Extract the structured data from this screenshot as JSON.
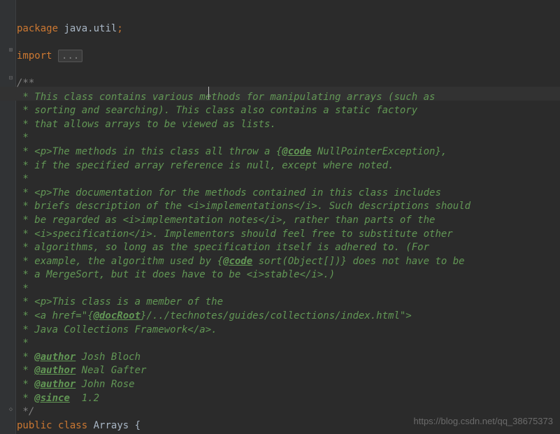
{
  "package_keyword": "package",
  "package_name": "java.util",
  "import_keyword": "import",
  "import_folded": "...",
  "doc": {
    "l0": "/**",
    "l1": " * This class contains various methods for manipulating arrays (such as",
    "l2": " * sorting and searching). This class also contains a static factory",
    "l3": " * that allows arrays to be viewed as lists.",
    "l4": " *",
    "l5a": " * <p>The methods in this class all throw a {",
    "l5tag": "@code",
    "l5b": " NullPointerException},",
    "l6": " * if the specified array reference is null, except where noted.",
    "l7": " *",
    "l8": " * <p>The documentation for the methods contained in this class includes",
    "l9": " * briefs description of the <i>implementations</i>. Such descriptions should",
    "l10": " * be regarded as <i>implementation notes</i>, rather than parts of the",
    "l11": " * <i>specification</i>. Implementors should feel free to substitute other",
    "l12": " * algorithms, so long as the specification itself is adhered to. (For",
    "l13a": " * example, the algorithm used by {",
    "l13tag": "@code",
    "l13b": " sort(Object[])} does not have to be",
    "l14": " * a MergeSort, but it does have to be <i>stable</i>.)",
    "l15": " *",
    "l16": " * <p>This class is a member of the",
    "l17a": " * <a href=\"{",
    "l17tag": "@docRoot",
    "l17b": "}/../technotes/guides/collections/index.html\">",
    "l18": " * Java Collections Framework</a>.",
    "l19": " *",
    "auth_tag": "@author",
    "auth1": " Josh Bloch",
    "auth2": " Neal Gafter",
    "auth3": " John Rose",
    "since_tag": "@since",
    "since_val": "  1.2",
    "lend": " */"
  },
  "class_public": "public",
  "class_kw": "class",
  "class_name": "Arrays",
  "brace": "{",
  "watermark": "https://blog.csdn.net/qq_38675373"
}
